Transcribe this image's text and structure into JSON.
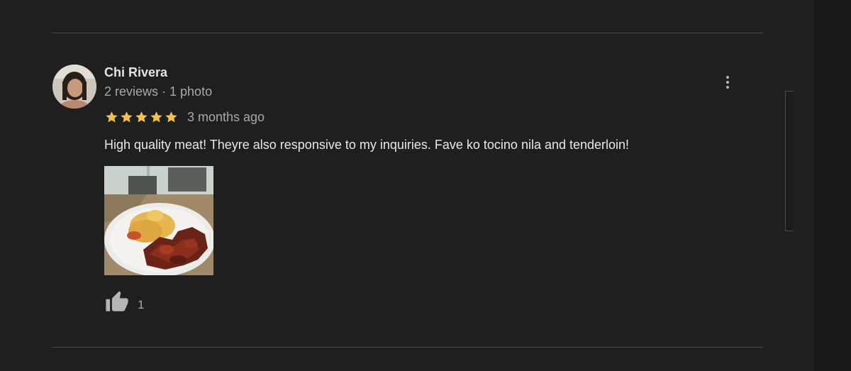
{
  "review": {
    "reviewer_name": "Chi Rivera",
    "reviewer_meta": "2 reviews · 1 photo",
    "rating": 5,
    "rating_max": 5,
    "date": "3 months ago",
    "text": "High quality meat! Theyre also responsive to my inquiries. Fave ko tocino nila and tenderloin!",
    "like_count": "1"
  },
  "icons": {
    "more": "more-vert-icon",
    "like": "thumb-up-icon",
    "star": "star-icon"
  },
  "colors": {
    "background": "#1f1f1f",
    "star": "#f5c147",
    "text_primary": "#e8e8e8",
    "text_secondary": "#a8a8a8",
    "divider": "#4a4a4a"
  }
}
